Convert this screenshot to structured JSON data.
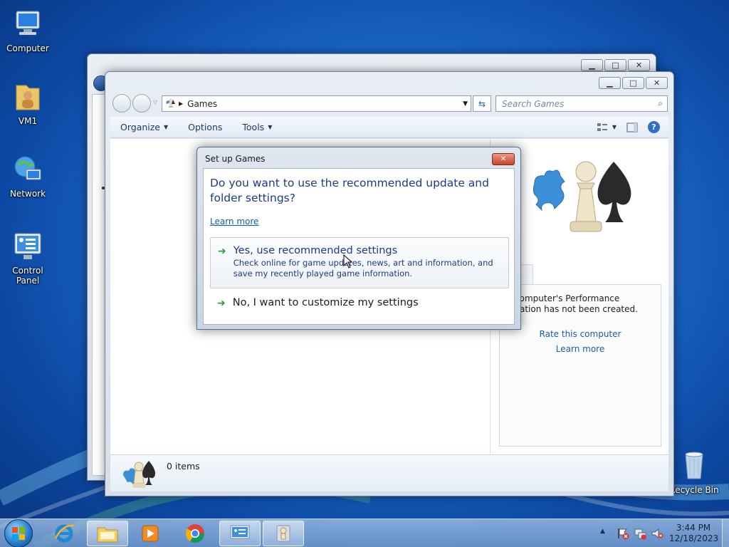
{
  "desktop": {
    "icons": [
      {
        "label": "Computer",
        "icon": "computer-icon"
      },
      {
        "label": "VM1",
        "icon": "user-folder-icon"
      },
      {
        "label": "Network",
        "icon": "network-icon"
      },
      {
        "label": "Control Panel",
        "icon": "control-panel-icon"
      },
      {
        "label": "Recycle Bin",
        "icon": "recycle-bin-icon"
      }
    ]
  },
  "explorer": {
    "breadcrumb": "Games",
    "search_placeholder": "Search Games",
    "commands": {
      "organize": "Organize",
      "options": "Options",
      "tools": "Tools"
    },
    "details": {
      "item_count": "0 items"
    },
    "right_pane": {
      "performance_text": "his computer's Performance formation has not been created.",
      "rate_link": "Rate this computer",
      "learn_link": "Learn more"
    }
  },
  "dialog": {
    "title": "Set up Games",
    "question": "Do you want to use the recommended update and folder settings?",
    "learn_more": "Learn more",
    "option_recommended": {
      "title": "Yes, use recommended settings",
      "description": "Check online for game updates, news, art and information, and save my recently played game information."
    },
    "option_customize": {
      "title": "No, I want to customize my settings"
    }
  },
  "taskbar": {
    "items": [
      "start-orb",
      "internet-explorer-icon",
      "windows-explorer-icon",
      "media-player-icon",
      "chrome-icon",
      "control-panel-icon",
      "games-icon"
    ],
    "clock": {
      "time": "3:44 PM",
      "date": "12/18/2023"
    }
  },
  "colors": {
    "link": "#0a5fb6",
    "dialog_heading": "#1c3a8a",
    "accent_green": "#2aa33c"
  }
}
